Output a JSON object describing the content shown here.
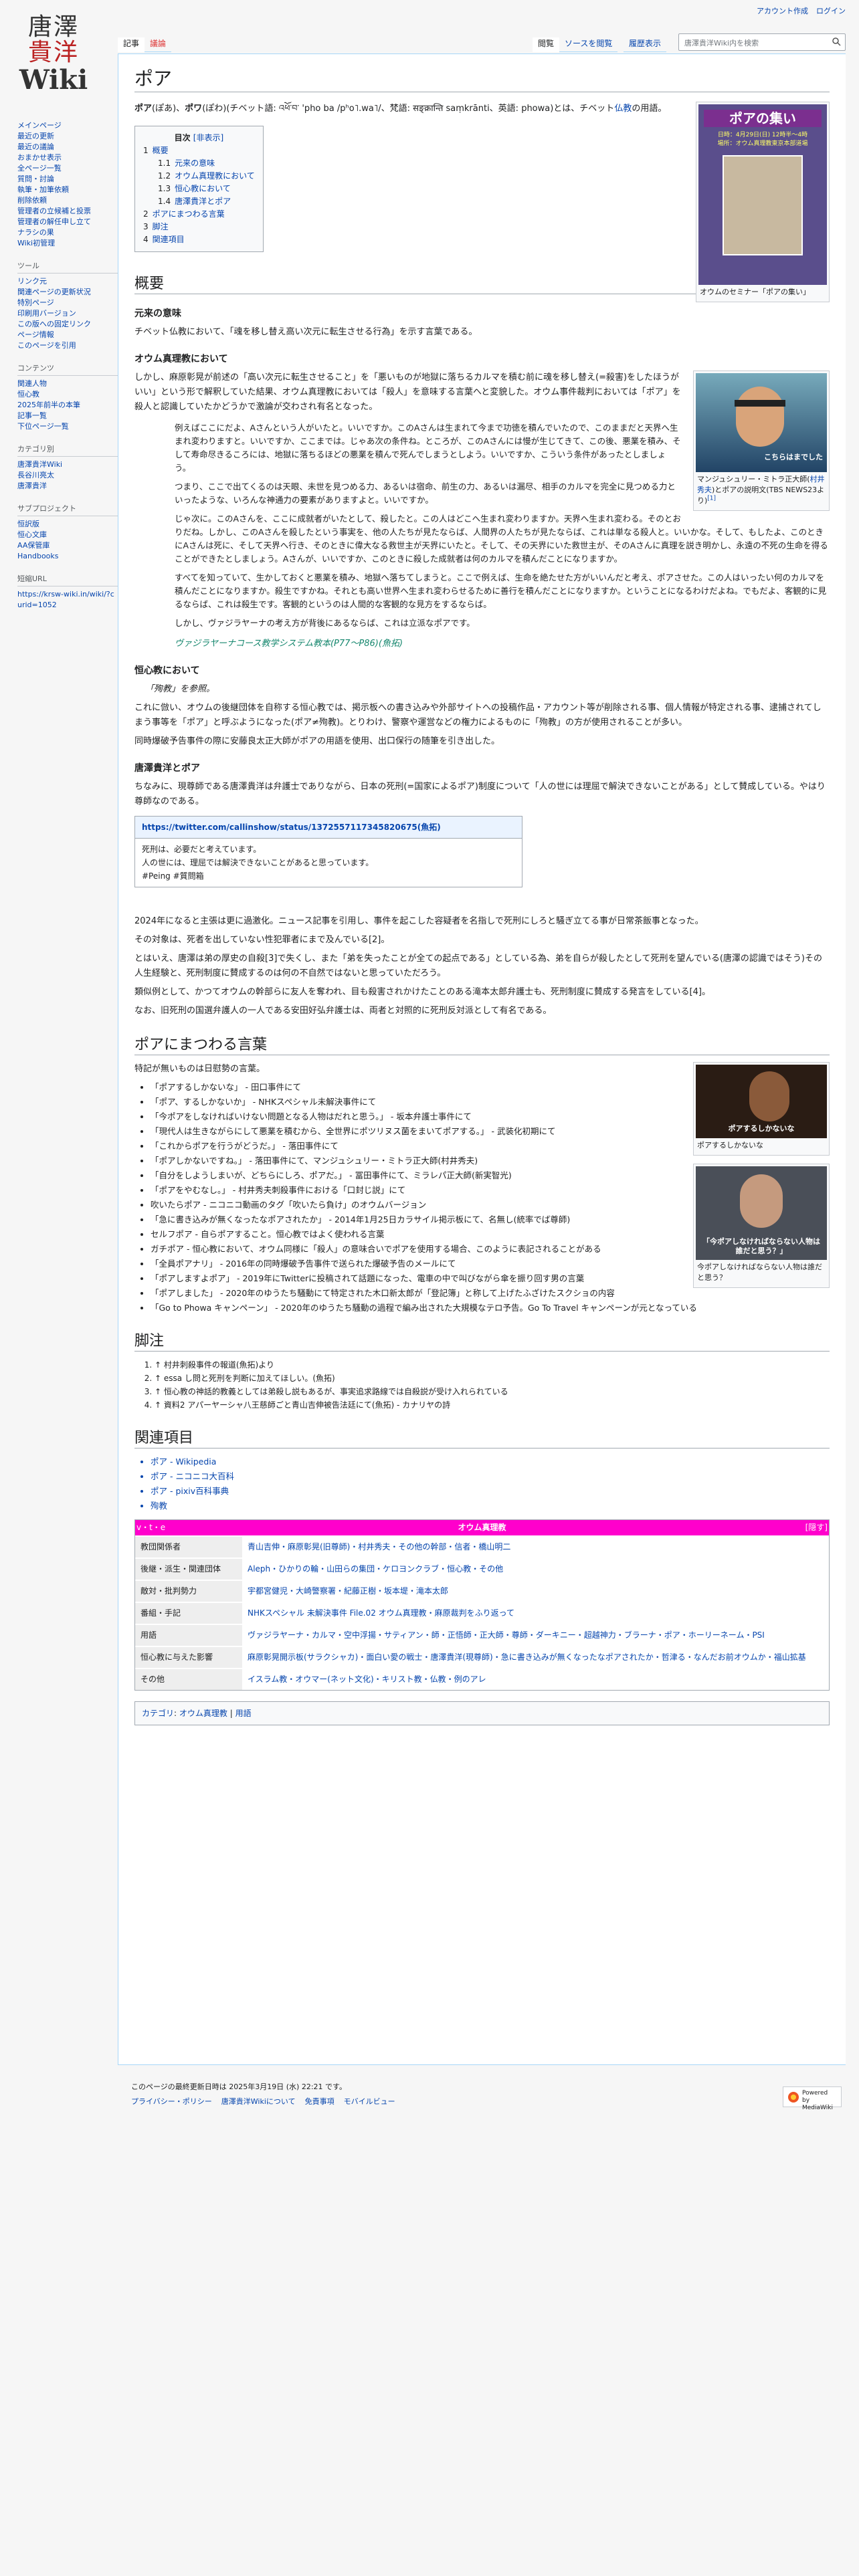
{
  "personal": {
    "create_account": "アカウント作成",
    "login": "ログイン"
  },
  "logo": {
    "line1": "唐澤",
    "line2": "貴洋",
    "line3": "Wiki"
  },
  "sidebar": {
    "nav": [
      "メインページ",
      "最近の更新",
      "最近の議論",
      "おまかせ表示",
      "全ページ一覧",
      "質問・討論",
      "執筆・加筆依頼",
      "削除依頼",
      "管理者の立候補と投票",
      "管理者の解任申し立て",
      "ナラシの果",
      "Wiki初管理"
    ],
    "tools_title": "ツール",
    "tools": [
      "リンク元",
      "関連ページの更新状況",
      "特別ページ",
      "印刷用バージョン",
      "この版への固定リンク",
      "ページ情報",
      "このページを引用"
    ],
    "contents_title": "コンテンツ",
    "contents": [
      "関連人物",
      "恒心教",
      "2025年前半の本筆",
      "記事一覧",
      "下位ページ一覧"
    ],
    "cat_title": "カテゴリ別",
    "cat": [
      "唐澤貴洋Wiki",
      "長谷川亮太",
      "唐澤貴洋"
    ],
    "project_title": "サブプロジェクト",
    "project": [
      "恒訳版",
      "恒心文庫",
      "AA保管庫",
      "Handbooks"
    ],
    "short_title": "短縮URL",
    "short": "https://krsw-wiki.in/wiki/?curid=1052"
  },
  "tabs": {
    "article": "記事",
    "talk": "議論",
    "read": "閲覧",
    "edit": "ソースを閲覧",
    "history": "履歴表示"
  },
  "search": {
    "placeholder": "唐澤貴洋Wiki内を検索"
  },
  "title": "ポア",
  "intro": {
    "a": "ポア",
    "b": "(ぽあ)、",
    "c": "ポワ",
    "d": "(ぽわ)(チベット語: འཕོ་བ་ 'pho ba /pʰo˥.wa˥/、梵語: सङ्क्रान्ति saṃkrānti、英語: phowa)とは、チベット",
    "link": "仏教",
    "e": "の用語。"
  },
  "toc": {
    "title": "目次",
    "toggle": "[非表示]",
    "items": [
      {
        "n": "1",
        "t": "概要",
        "lvl": 1
      },
      {
        "n": "1.1",
        "t": "元来の意味",
        "lvl": 2
      },
      {
        "n": "1.2",
        "t": "オウム真理教において",
        "lvl": 2
      },
      {
        "n": "1.3",
        "t": "恒心教において",
        "lvl": 2
      },
      {
        "n": "1.4",
        "t": "唐澤貴洋とポア",
        "lvl": 2
      },
      {
        "n": "2",
        "t": "ポアにまつわる言葉",
        "lvl": 1
      },
      {
        "n": "3",
        "t": "脚注",
        "lvl": 1
      },
      {
        "n": "4",
        "t": "関連項目",
        "lvl": 1
      }
    ]
  },
  "thumb1": {
    "poster_title": "ポアの集い",
    "poster_sub": "日時：4月29日(日) 12時半～4時",
    "poster_sub2": "場所：オウム真理教東京本部道場",
    "caption": "オウムのセミナー「ポアの集い」"
  },
  "thumb2": {
    "caption_a": "マンジュシュリー・ミトラ正大師(",
    "caption_link": "村井秀夫",
    "caption_b": ")とポアの説明文(TBS NEWS23より)",
    "sup": "[1]",
    "tv": "こちらはまでした"
  },
  "thumb3": {
    "caption": "ポアするしかないな",
    "overlay": "ポアするしかないな"
  },
  "thumb4": {
    "caption": "今ポアしなければならない人物は誰だと思う？",
    "overlay": "「今ポアしなければならない人物は誰だと思う？」"
  },
  "s_overview": "概要",
  "s_origin": "元来の意味",
  "origin_text": "チベット仏教において、「魂を移し替え高い次元に転生させる行為」を示す言葉である。",
  "s_aum": "オウム真理教において",
  "aum_p1": "しかし、麻原彰晃が前述の「高い次元に転生させること」を「悪いものが地獄に落ちるカルマを積む前に魂を移し替え(=殺害)をしたほうがいい」という形で解釈していた結果、オウム真理教においては「殺人」を意味する言葉へと変貌した。オウム事件裁判においては「ポア」を殺人と認識していたかどうかで激論が交わされ有名となった。",
  "quote": [
    "例えばここにだよ、Aさんという人がいたと。いいですか。このAさんは生まれて今まで功徳を積んでいたので、このままだと天界へ生まれ変わりますと。いいですか、ここまでは。じゃあ次の条件ね。ところが、このAさんには慢が生じてきて、この後、悪業を積み、そして寿命尽きるころには、地獄に落ちるほどの悪業を積んで死んでしまうとしよう。いいですか、こういう条件があったとしましょう。",
    "つまり、ここで出てくるのは天眼、未世を見つめる力、あるいは宿命、前生の力、あるいは漏尽、相手のカルマを完全に見つめる力といったような、いろんな神通力の要素がありますよと。いいですか。",
    "じゃ次に。このAさんを、ここに成就者がいたとして、殺したと。この人はどこへ生まれ変わりますか。天界へ生まれ変わる。そのとおりだね。しかし、このAさんを殺したという事実を、他の人たちが見たならば、人間界の人たちが見たならば、これは単なる殺人と。いいかな。そして、もしたよ、このときにAさんは死に、そして天界へ行き、そのときに偉大なる救世主が天界にいたと。そして、その天界にいた救世主が、そのAさんに真理を説き明かし、永遠の不死の生命を得ることができたとしましょう。Aさんが、いいですか、このときに殺した成就者は何のカルマを積んだことになりますか。",
    "すべてを知っていて、生かしておくと悪業を積み、地獄へ落ちてしまうと。ここで例えば、生命を絶たせた方がいいんだと考え、ポアさせた。この人はいったい何のカルマを積んだことになりますか。殺生ですかね。それとも高い世界へ生まれ変わらせるために善行を積んだことになりますか。ということになるわけだよね。でもだよ、客観的に見るならば、これは殺生です。客観的というのは人間的な客観的な見方をするならば。",
    "しかし、ヴァジラヤーナの考え方が背後にあるならば、これは立派なポアです。"
  ],
  "quote_source": "ヴァジラヤーナコース教学システム教本(P77〜P86)(魚拓)",
  "s_koushin": "恒心教において",
  "koushin_ref": "「殉教」を参照。",
  "koushin_p": "これに倣い、オウムの後継団体を自称する恒心教では、掲示板への書き込みや外部サイトへの投稿作品・アカウント等が削除される事、個人情報が特定される事、逮捕されてしまう事等を「ポア」と呼ぶようになった(ポア≠殉教)。とりわけ、警察や運営などの権力によるものに「殉教」の方が使用されることが多い。",
  "koushin_p2": "同時爆破予告事件の際に安藤良太正大師がポアの用語を使用、出口保行の随筆を引き出した。",
  "s_kara": "唐澤貴洋とポア",
  "kara_p": "ちなみに、現尊師である唐澤貴洋は弁護士でありながら、日本の死刑(=国家によるポア)制度について「人の世には理屈で解決できないことがある」として賛成している。やはり尊師なのである。",
  "tweet": {
    "url": "https://twitter.com/callinshow/status/1372557117345820675(魚拓)",
    "lines": [
      "死刑は、必要だと考えています。",
      "人の世には、理屈では解決できないことがあると思っています。",
      "#Peing #質問箱"
    ]
  },
  "kara_p2": "2024年になると主張は更に過激化。ニュース記事を引用し、事件を起こした容疑者を名指しで死刑にしろと騒ぎ立てる事が日常茶飯事となった。",
  "kara_p3": "その対象は、死者を出していない性犯罪者にまで及んでいる[2]。",
  "kara_p4": "とはいえ、唐澤は弟の厚史の自殺[3]で失くし、また「弟を失ったことが全ての起点である」としている為、弟を自らが殺したとして死刑を望んでいる(唐澤の認識ではそう)その人生経験と、死刑制度に賛成するのは何の不自然ではないと思っていただろう。",
  "kara_p5": "類似例として、かつてオウムの幹部らに友人を奪われ、目も殺害されかけたことのある滝本太郎弁護士も、死刑制度に賛成する発言をしている[4]。",
  "kara_p6": "なお、旧死刑の国選弁護人の一人である安田好弘弁護士は、両者と対照的に死刑反対派として有名である。",
  "s_words": "ポアにまつわる言葉",
  "words_intro": "特記が無いものは日慰勢の言葉。",
  "words": [
    "「ポアするしかないな」 - 田口事件にて",
    "「ポア、するしかないか」 - NHKスペシャル未解決事件にて",
    "「今ポアをしなければいけない問題となる人物はだれと思う。」 - 坂本弁護士事件にて",
    "「現代人は生きながらにして悪業を積むから、全世界にポツリヌス菌をまいてポアする。」 - 武装化初期にて",
    "「これからポアを行うがどうだ。」 - 落田事件にて",
    "「ポアしかないですね。」 - 落田事件にて、マンジュシュリー・ミトラ正大師(村井秀夫)",
    "「自分をしようしまいが、どちらにしろ、ポアだ。」 - 冨田事件にて、ミラレパ正大師(新実智光)",
    "「ポアをやむなし。」 - 村井秀夫刺殺事件における「口封じ説」にて",
    "吹いたらポア - ニコニコ動画のタグ「吹いたら負け」のオウムバージョン",
    "「急に書き込みが無くなったなポアされたか」 - 2014年1月25日カラサイル掲示板にて、名無し(統率でば尊師)",
    "セルフポア - 自らポアすること。恒心教ではよく使われる言葉",
    "ガチポア - 恒心教において、オウム同様に「殺人」の意味合いでポアを使用する場合、このように表記されることがある",
    "「全員ポアナリ」 - 2016年の同時爆破予告事件で送られた爆破予告のメールにて",
    "「ポアしますよポア」 - 2019年にTwitterに投稿されて話題になった、電車の中で叫びながら傘を振り回す男の言葉",
    "「ポアしました」 - 2020年のゆうたち騒動にて特定された木口新太郎が「登記簿」と称して上げたふざけたスクショの内容",
    "「Go to Phowa キャンペーン」 - 2020年のゆうたち騒動の過程で編み出された大規模なテロ予告。Go To Travel キャンペーンが元となっている"
  ],
  "s_notes": "脚注",
  "notes": [
    "↑ 村井刺殺事件の報道(魚拓)より",
    "↑ essa し問と死刑を判断に加えてほしい。(魚拓)",
    "↑ 恒心教の神話的教義としては弟殺し説もあるが、事実追求路線では自殺説が受け入れられている",
    "↑ 資料2 アパーヤーシャ八王慈師ごと青山吉伸被告法廷にて(魚拓) - カナリヤの詩"
  ],
  "s_related": "関連項目",
  "related": [
    "ポア - Wikipedia",
    "ポア - ニコニコ大百科",
    "ポア - pixiv百科事典",
    "殉教"
  ],
  "navbox": {
    "title": "オウム真理教",
    "vde": "v・t・e",
    "hide": "[隠す]",
    "rows": [
      {
        "g": "教団関係者",
        "l": "青山吉伸・麻原彰晃(旧尊師)・村井秀夫・その他の幹部・信者・橋山明二"
      },
      {
        "g": "後継・派生・関連団体",
        "l": "Aleph・ひかりの輪・山田らの集団・ケロヨンクラブ・恒心教・その他"
      },
      {
        "g": "敵対・批判勢力",
        "l": "宇都宮健児・大崎警察署・紀藤正樹・坂本堤・滝本太郎"
      },
      {
        "g": "番組・手記",
        "l": "NHKスペシャル 未解決事件 File.02 オウム真理教・麻原裁判をふり返って"
      },
      {
        "g": "用語",
        "l": "ヴァジラヤーナ・カルマ・空中浮揚・サティアン・師・正悟師・正大師・尊師・ダーキニー・超越神力・ブラーナ・ポア・ホーリーネーム・PSI"
      },
      {
        "g": "恒心教に与えた影響",
        "l": "麻原彰晃開示板(サラクシャカ)・面白い愛の戦士・唐澤貴洋(現尊師)・急に書き込みが無くなったなポアされたか・哲津る・なんだお前オウムか・福山拡基"
      },
      {
        "g": "その他",
        "l": "イスラム教・オウマー(ネット文化)・キリスト教・仏教・例のアレ"
      }
    ]
  },
  "categories": {
    "label": "カテゴリ",
    "items": [
      "オウム真理教",
      "用語"
    ]
  },
  "footer": {
    "last_edit": "このページの最終更新日時は 2025年3月19日 (水) 22:21 です。",
    "links": [
      "プライバシー・ポリシー",
      "唐澤貴洋Wikiについて",
      "免責事項",
      "モバイルビュー"
    ],
    "powered": "Powered by MediaWiki"
  }
}
